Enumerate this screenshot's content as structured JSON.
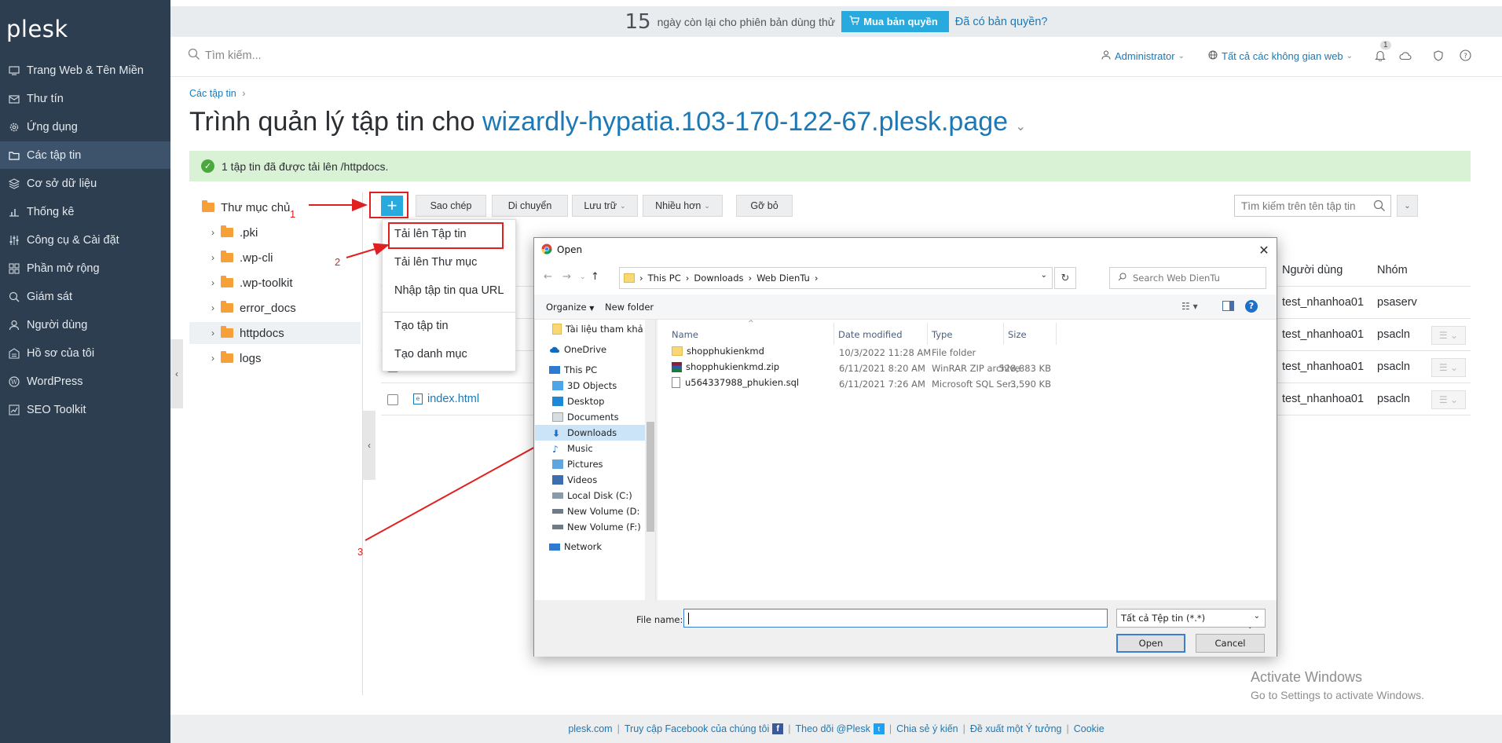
{
  "sidebar": {
    "logo": "plesk",
    "items": [
      {
        "label": "Trang Web & Tên Miền",
        "icon": "monitor-icon"
      },
      {
        "label": "Thư tín",
        "icon": "mail-icon"
      },
      {
        "label": "Ứng dụng",
        "icon": "gear-icon"
      },
      {
        "label": "Các tập tin",
        "icon": "folder-icon",
        "active": true
      },
      {
        "label": "Cơ sở dữ liệu",
        "icon": "database-icon"
      },
      {
        "label": "Thống kê",
        "icon": "chart-icon"
      },
      {
        "label": "Công cụ & Cài đặt",
        "icon": "sliders-icon"
      },
      {
        "label": "Phần mở rộng",
        "icon": "puzzle-icon"
      },
      {
        "label": "Giám sát",
        "icon": "monitor-search-icon"
      },
      {
        "label": "Người dùng",
        "icon": "user-icon"
      },
      {
        "label": "Hồ sơ của tôi",
        "icon": "profile-icon"
      },
      {
        "label": "WordPress",
        "icon": "wordpress-icon"
      },
      {
        "label": "SEO Toolkit",
        "icon": "seo-icon"
      }
    ]
  },
  "trial": {
    "days": "15",
    "text": "ngày còn lại cho phiên bản dùng thử",
    "buy_label": "Mua bản quyền",
    "have_license": "Đã có bản quyền?"
  },
  "header": {
    "search_placeholder": "Tìm kiếm...",
    "user": "Administrator",
    "subscriptions": "Tất cả các không gian web",
    "notifications_count": "1"
  },
  "breadcrumb": "Các tập tin",
  "title": {
    "prefix": "Trình quản lý tập tin cho",
    "domain": "wizardly-hypatia.103-170-122-67.plesk.page"
  },
  "message": "1 tập tin đã được tải lên /httpdocs.",
  "tree": {
    "root": "Thư mục chủ",
    "children": [
      ".pki",
      ".wp-cli",
      ".wp-toolkit",
      "error_docs",
      "httpdocs",
      "logs"
    ]
  },
  "toolbar": {
    "add": "+",
    "copy": "Sao chép",
    "move": "Di chuyển",
    "archive": "Lưu trữ",
    "more": "Nhiều hơn",
    "remove": "Gỡ bỏ",
    "search_placeholder": "Tìm kiếm trên tên tập tin"
  },
  "table": {
    "headers": {
      "user": "Người dùng",
      "group": "Nhóm"
    },
    "rows": [
      {
        "name": "",
        "user": "test_nhanhoa01",
        "group": "psaserv"
      },
      {
        "name": "",
        "user": "test_nhanhoa01",
        "group": "psacln"
      },
      {
        "name": "",
        "user": "test_nhanhoa01",
        "group": "psacln"
      },
      {
        "name": "index.html",
        "user": "test_nhanhoa01",
        "group": "psacln"
      }
    ]
  },
  "dropdown": {
    "items": [
      "Tải lên Tập tin",
      "Tải lên Thư mục",
      "Nhập tập tin qua URL",
      "Tạo tập tin",
      "Tạo danh mục"
    ]
  },
  "annotations": [
    "1",
    "2",
    "3"
  ],
  "dialog": {
    "title": "Open",
    "path": [
      "This PC",
      "Downloads",
      "Web DienTu"
    ],
    "search_placeholder": "Search Web DienTu",
    "organize": "Organize",
    "new_folder": "New folder",
    "left_pane": [
      {
        "label": "Tài liệu tham khả",
        "icon": "folder-icon"
      },
      {
        "label": "OneDrive",
        "icon": "cloud-icon"
      },
      {
        "label": "This PC",
        "icon": "computer-icon"
      },
      {
        "label": "3D Objects",
        "icon": "cube-icon"
      },
      {
        "label": "Desktop",
        "icon": "desktop-icon"
      },
      {
        "label": "Documents",
        "icon": "document-icon"
      },
      {
        "label": "Downloads",
        "icon": "download-icon",
        "selected": true
      },
      {
        "label": "Music",
        "icon": "music-icon"
      },
      {
        "label": "Pictures",
        "icon": "picture-icon"
      },
      {
        "label": "Videos",
        "icon": "video-icon"
      },
      {
        "label": "Local Disk (C:)",
        "icon": "disk-icon"
      },
      {
        "label": "New Volume (D:",
        "icon": "drive-icon"
      },
      {
        "label": "New Volume (F:)",
        "icon": "drive-icon"
      },
      {
        "label": "Network",
        "icon": "network-icon"
      }
    ],
    "columns": {
      "name": "Name",
      "date": "Date modified",
      "type": "Type",
      "size": "Size"
    },
    "files": [
      {
        "name": "shopphukienkmd",
        "date": "10/3/2022 11:28 AM",
        "type": "File folder",
        "size": "",
        "icon": "folder-icon"
      },
      {
        "name": "shopphukienkmd.zip",
        "date": "6/11/2021 8:20 AM",
        "type": "WinRAR ZIP archive",
        "size": "528,883 KB",
        "icon": "winrar-icon"
      },
      {
        "name": "u564337988_phukien.sql",
        "date": "6/11/2021 7:26 AM",
        "type": "Microsoft SQL Ser...",
        "size": "3,590 KB",
        "icon": "file-icon"
      }
    ],
    "file_name_label": "File name:",
    "file_name_value": "",
    "file_type": "Tất cả Tệp tin (*.*)",
    "open_label": "Open",
    "cancel_label": "Cancel"
  },
  "footer": {
    "links": [
      "plesk.com",
      "Truy cập Facebook của chúng tôi",
      "Theo dõi @Plesk",
      "Chia sẻ ý kiến",
      "Đề xuất một Ý tưởng",
      "Cookie"
    ]
  },
  "watermark": {
    "title": "Activate Windows",
    "subtitle": "Go to Settings to activate Windows."
  },
  "colors": {
    "sidebar": "#2c3e50",
    "accent": "#28aade",
    "link": "#1d79b5",
    "success_bg": "#d9f1d4",
    "annotation": "#e02020"
  }
}
